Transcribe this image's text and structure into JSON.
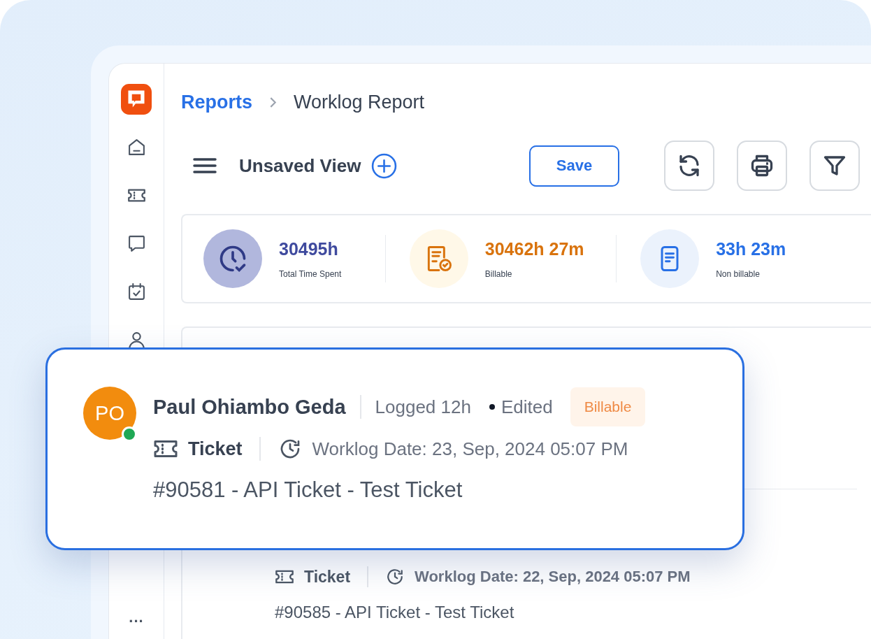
{
  "sidebar": {
    "more": "..."
  },
  "breadcrumb": [
    {
      "label": "Reports",
      "kind": "link"
    },
    {
      "label": "Worklog Report",
      "kind": "current"
    }
  ],
  "toolbar": {
    "view_title": "Unsaved View",
    "save_button": "Save"
  },
  "stats": [
    {
      "kind": "clock",
      "value": "30495h",
      "label": "Total Time Spent",
      "color": "#3f4a9e"
    },
    {
      "kind": "billable",
      "value": "30462h 27m",
      "label": "Billable",
      "color": "#d9730d"
    },
    {
      "kind": "document",
      "value": "33h 23m",
      "label": "Non billable",
      "color": "#2870e6"
    }
  ],
  "highlighted_entry": {
    "initials": "PO",
    "online": true,
    "author": "Paul Ohiambo Geda",
    "logged": "Logged 12h",
    "edited": "Edited",
    "badge": "Billable",
    "type_label": "Ticket",
    "date": "Worklog Date: 23, Sep, 2024 05:07 PM",
    "title": "#90581 - API Ticket - Test Ticket"
  },
  "entries": [
    {
      "type_label": "Ticket",
      "date": "Worklog Date: 22, Sep, 2024 05:07 PM",
      "title": "#90585 - API Ticket - Test Ticket"
    }
  ]
}
